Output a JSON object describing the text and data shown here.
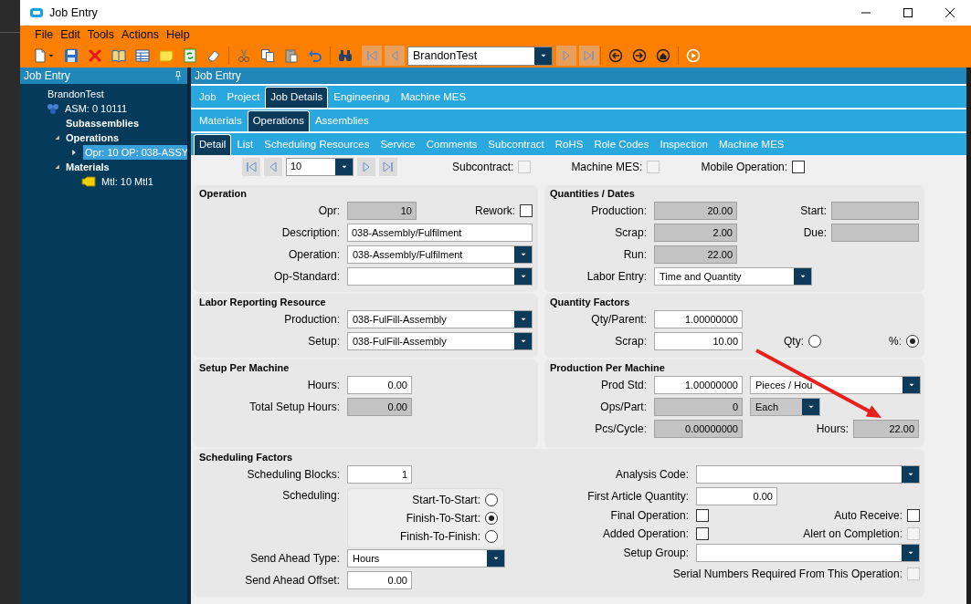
{
  "window": {
    "title": "Job Entry"
  },
  "menu": [
    "File",
    "Edit",
    "Tools",
    "Actions",
    "Help"
  ],
  "toolbar": {
    "record": "BrandonTest"
  },
  "tree_panel": {
    "title": "Job Entry",
    "items": [
      {
        "label": "BrandonTest",
        "kind": "job",
        "selected": false
      },
      {
        "label": "ASM: 0 10111",
        "kind": "assembly",
        "selected": false,
        "children": [
          {
            "label": "Subassemblies",
            "kind": "group",
            "selected": false
          },
          {
            "label": "Operations",
            "kind": "group",
            "selected": false,
            "expanded": true,
            "children": [
              {
                "label": "Opr: 10 OP: 038-ASSY",
                "kind": "operation",
                "selected": true,
                "expanded": false
              }
            ]
          },
          {
            "label": "Materials",
            "kind": "group",
            "selected": false,
            "expanded": true,
            "children": [
              {
                "label": "Mtl: 10 Mtl1",
                "kind": "material",
                "selected": false
              }
            ]
          }
        ]
      }
    ]
  },
  "main_panel": {
    "title": "Job Entry"
  },
  "tab_rows": [
    [
      {
        "label": "Job",
        "selected": false
      },
      {
        "label": "Project",
        "selected": false
      },
      {
        "label": "Job Details",
        "selected": true
      },
      {
        "label": "Engineering",
        "selected": false
      },
      {
        "label": "Machine MES",
        "selected": false
      }
    ],
    [
      {
        "label": "Materials",
        "selected": false
      },
      {
        "label": "Operations",
        "selected": true
      },
      {
        "label": "Assemblies",
        "selected": false
      }
    ],
    [
      {
        "label": "Detail",
        "selected": true
      },
      {
        "label": "List",
        "selected": false
      },
      {
        "label": "Scheduling Resources",
        "selected": false
      },
      {
        "label": "Service",
        "selected": false
      },
      {
        "label": "Comments",
        "selected": false
      },
      {
        "label": "Subcontract",
        "selected": false
      },
      {
        "label": "RoHS",
        "selected": false
      },
      {
        "label": "Role Codes",
        "selected": false
      },
      {
        "label": "Inspection",
        "selected": false
      },
      {
        "label": "Machine MES",
        "selected": false
      }
    ]
  ],
  "navigator": {
    "value": "10",
    "checks": [
      {
        "label": "Subcontract:",
        "checked": false,
        "disabled": true
      },
      {
        "label": "Machine MES:",
        "checked": false,
        "disabled": true
      },
      {
        "label": "Mobile Operation:",
        "checked": false,
        "disabled": false
      }
    ]
  },
  "sections": [
    {
      "title": "Operation",
      "rows": [
        [
          {
            "label": "Opr:",
            "kind": "readonly",
            "value": "10"
          },
          {
            "label": "Rework:",
            "kind": "checkbox",
            "checked": false,
            "disabled": false
          }
        ],
        [
          {
            "label": "Description:",
            "kind": "text",
            "value": "038-Assembly/Fulfilment"
          }
        ],
        [
          {
            "label": "Operation:",
            "kind": "combo",
            "value": "038-Assembly/Fulfilment",
            "disabled": false
          }
        ],
        [
          {
            "label": "Op-Standard:",
            "kind": "combo",
            "disabled": false
          }
        ]
      ]
    },
    {
      "title": "Quantities / Dates",
      "rows": [
        [
          {
            "label": "Production:",
            "kind": "readonly",
            "value": "20.00"
          },
          {
            "label": "Start:",
            "kind": "readonly"
          }
        ],
        [
          {
            "label": "Scrap:",
            "kind": "readonly",
            "value": "2.00"
          },
          {
            "label": "Due:",
            "kind": "readonly"
          }
        ],
        [
          {
            "label": "Run:",
            "kind": "readonly",
            "value": "22.00"
          }
        ],
        [
          {
            "label": "Labor Entry:",
            "kind": "combo",
            "value": "Time and Quantity",
            "disabled": false
          }
        ]
      ]
    },
    {
      "title": "Labor Reporting Resource",
      "rows": [
        [
          {
            "label": "Production:",
            "kind": "combo",
            "value": "038-FulFill-Assembly",
            "disabled": false
          }
        ],
        [
          {
            "label": "Setup:",
            "kind": "combo",
            "value": "038-FulFill-Assembly",
            "disabled": false
          }
        ]
      ]
    },
    {
      "title": "Quantity Factors",
      "rows": [
        [
          {
            "label": "Qty/Parent:",
            "kind": "number",
            "value": "1.00000000"
          }
        ],
        [
          {
            "label": "Scrap:",
            "kind": "number",
            "value": "10.00"
          },
          {
            "label": "Qty:",
            "kind": "radio",
            "selected": false
          },
          {
            "label": "%:",
            "kind": "radio",
            "selected": true
          }
        ]
      ]
    },
    {
      "title": "Setup Per Machine",
      "rows": [
        [
          {
            "label": "Hours:",
            "kind": "number",
            "value": "0.00"
          }
        ],
        [
          {
            "label": "Total Setup Hours:",
            "kind": "readonly",
            "value": "0.00"
          }
        ]
      ]
    },
    {
      "title": "Production Per Machine",
      "rows": [
        [
          {
            "label": "Prod Std:",
            "kind": "number",
            "value": "1.00000000"
          },
          {
            "kind": "combo",
            "value": "Pieces / Hou",
            "disabled": false
          }
        ],
        [
          {
            "label": "Ops/Part:",
            "kind": "readonly",
            "value": "0"
          },
          {
            "kind": "combo",
            "value": "Each",
            "disabled": true
          }
        ],
        [
          {
            "label": "Pcs/Cycle:",
            "kind": "readonly",
            "value": "0.00000000"
          },
          {
            "label": "Hours:",
            "kind": "readonly",
            "value": "22.00"
          }
        ]
      ]
    },
    {
      "title": "Scheduling Factors",
      "columns": [
        [
          [
            {
              "label": "Scheduling Blocks:",
              "kind": "number",
              "value": "1"
            }
          ],
          [
            {
              "label": "Scheduling:",
              "kind": "radio_group",
              "options": [
                {
                  "label": "Start-To-Start:",
                  "selected": false
                },
                {
                  "label": "Finish-To-Start:",
                  "selected": true
                },
                {
                  "label": "Finish-To-Finish:",
                  "selected": false
                }
              ]
            }
          ],
          [
            {
              "label": "Send Ahead Type:",
              "kind": "combo",
              "value": "Hours",
              "disabled": false
            }
          ],
          [
            {
              "label": "Send Ahead Offset:",
              "kind": "number",
              "value": "0.00"
            }
          ]
        ],
        [
          [
            {
              "label": "Analysis Code:",
              "kind": "combo",
              "disabled": false
            }
          ],
          [
            {
              "label": "First Article Quantity:",
              "kind": "number",
              "value": "0.00"
            }
          ],
          [
            {
              "label": "Final Operation:",
              "kind": "checkbox",
              "checked": false,
              "disabled": false
            },
            {
              "label": "Auto Receive:",
              "kind": "checkbox",
              "checked": false,
              "disabled": false
            }
          ],
          [
            {
              "label": "Added Operation:",
              "kind": "checkbox",
              "checked": false,
              "disabled": false
            },
            {
              "label": "Alert on Completion:",
              "kind": "checkbox",
              "checked": false,
              "disabled": true
            }
          ],
          [
            {
              "label": "Setup Group:",
              "kind": "combo",
              "disabled": false
            }
          ],
          [
            {
              "label": "Serial Numbers Required From This Operation:",
              "kind": "checkbox",
              "checked": false,
              "disabled": true
            }
          ]
        ]
      ]
    }
  ]
}
